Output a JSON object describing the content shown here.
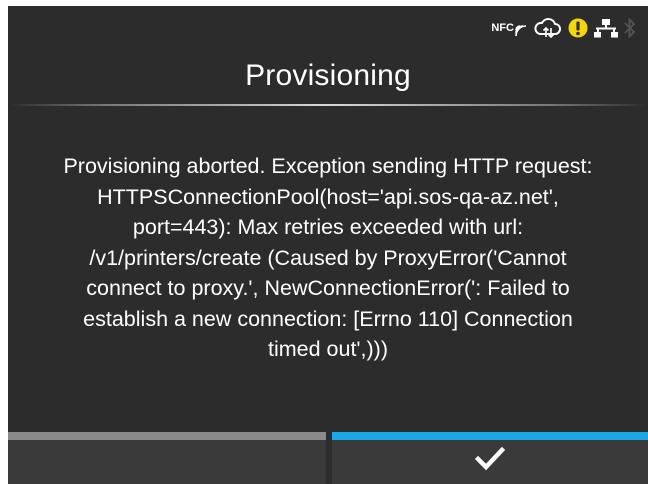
{
  "status_bar": {
    "nfc_label": "NFC",
    "icons": [
      "nfc-icon",
      "cloud-sync-icon",
      "warning-icon",
      "network-icon",
      "bluetooth-icon"
    ],
    "warning_color": "#f5d800",
    "bluetooth_color": "#555555"
  },
  "screen": {
    "title": "Provisioning",
    "message_lines": [
      "Provisioning aborted. Exception sending HTTP request:",
      "HTTPSConnectionPool(host='api.sos-qa-az.net',",
      "port=443): Max retries exceeded with url:",
      "/v1/printers/create (Caused by ProxyError('Cannot",
      "connect to proxy.', NewConnectionError(': Failed to",
      "establish a new connection: [Errno 110] Connection",
      "timed out',)))"
    ]
  },
  "softkeys": {
    "left": {
      "label": ""
    },
    "right": {
      "icon": "checkmark-icon"
    },
    "accent_left": "#8a8a8a",
    "accent_right": "#1aa7e8"
  }
}
